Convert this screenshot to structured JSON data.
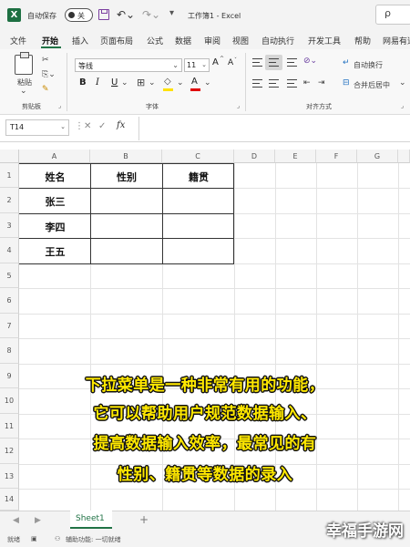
{
  "titlebar": {
    "autosave_label": "自动保存",
    "autosave_state": "关",
    "window_title": "工作簿1 - Excel",
    "search_glyph": "ρ"
  },
  "menu": {
    "tabs": [
      "文件",
      "开始",
      "插入",
      "页面布局",
      "公式",
      "数据",
      "审阅",
      "视图",
      "自动执行",
      "开发工具",
      "帮助",
      "网易有道"
    ],
    "active": "开始"
  },
  "ribbon": {
    "paste_label": "粘贴",
    "clipboard_group": "剪贴板",
    "font_name": "等线",
    "font_size": "11",
    "grow_font": "A",
    "shrink_font": "A",
    "bold": "B",
    "italic": "I",
    "underline": "U",
    "font_color_letter": "A",
    "font_group": "字体",
    "alignment_group": "对齐方式",
    "wrap_text": "自动换行",
    "merge_center": "合并后居中",
    "accent_color": "#217346"
  },
  "formula_bar": {
    "name_box": "T14",
    "fx": "fx",
    "value": ""
  },
  "grid": {
    "columns": [
      "A",
      "B",
      "C",
      "D",
      "E",
      "F",
      "G"
    ],
    "rows": [
      "1",
      "2",
      "3",
      "4",
      "5",
      "6",
      "7",
      "8",
      "9",
      "10",
      "11",
      "12",
      "13",
      "14"
    ],
    "cells": {
      "A1": "姓名",
      "B1": "性别",
      "C1": "籍贯",
      "A2": "张三",
      "A3": "李四",
      "A4": "王五"
    }
  },
  "caption": {
    "lines": [
      "下拉菜单是一种非常有用的功能，",
      "它可以帮助用户规范数据输入、",
      "提高数据输入效率，最常见的有",
      "性别、籍贯等数据的录入"
    ],
    "color": "#ffe800"
  },
  "sheets": {
    "tabs": [
      "Sheet1"
    ],
    "add": "+"
  },
  "status": {
    "ready": "就绪",
    "accessibility": "辅助功能: 一切就绪"
  },
  "watermark": "幸福手游网"
}
